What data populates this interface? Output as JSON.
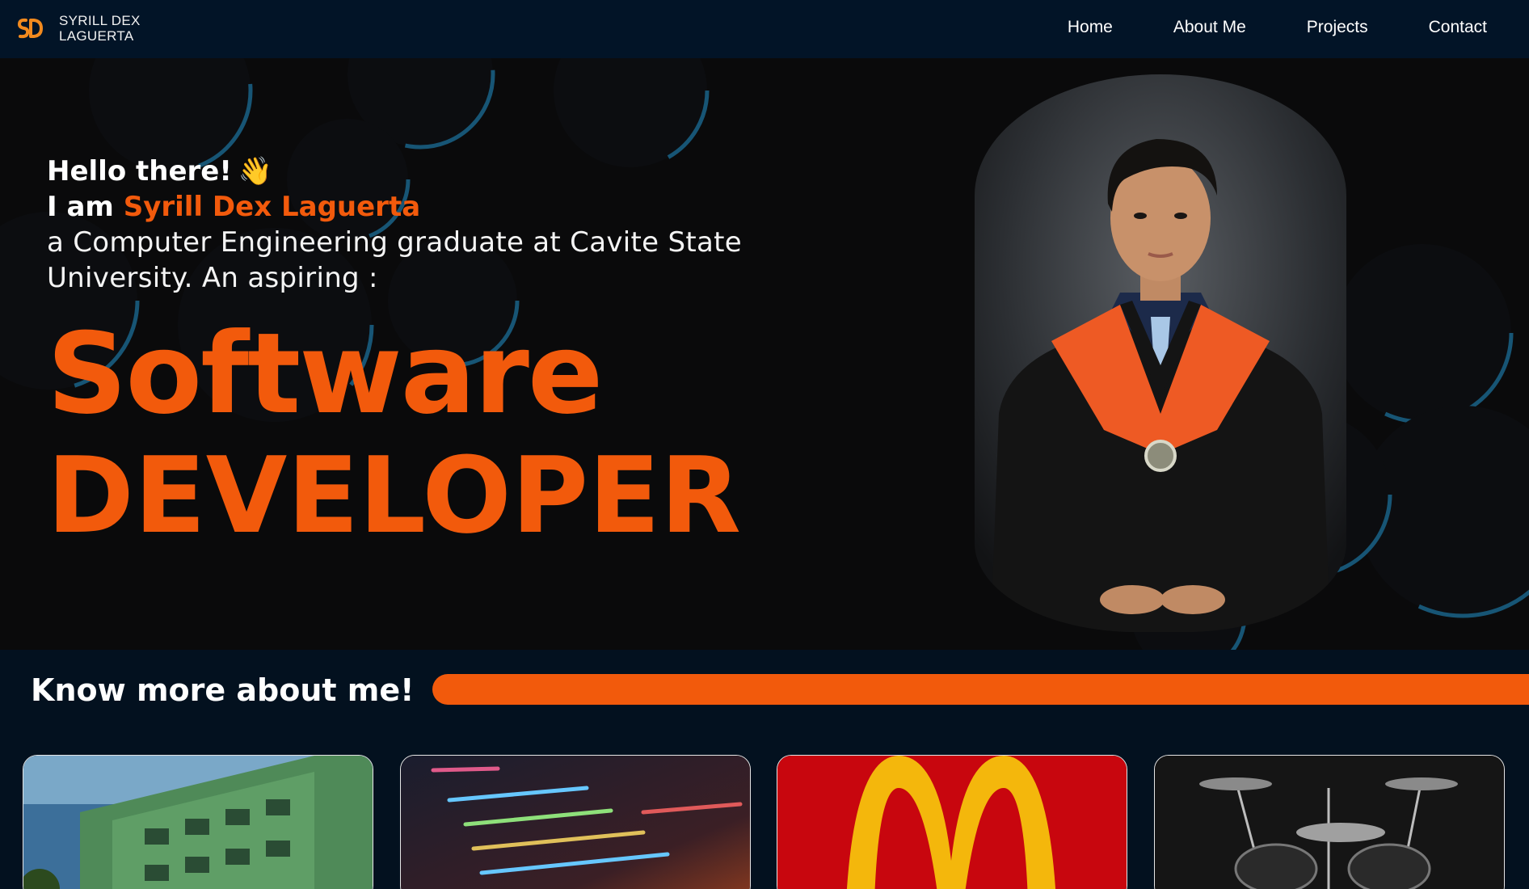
{
  "nav": {
    "logo_mark": "SD",
    "logo_line1": "SYRILL DEX",
    "logo_line2": "LAGUERTA",
    "links": [
      "Home",
      "About Me",
      "Projects",
      "Contact"
    ]
  },
  "hero": {
    "greeting": "Hello there!",
    "wave": "👋",
    "iam_prefix": "I am ",
    "name": "Syrill Dex Laguerta",
    "description": "a Computer Engineering graduate at Cavite State University. An aspiring :",
    "role_line1": "Software",
    "role_line2": "DEVELOPER"
  },
  "about": {
    "title": "Know more about me!",
    "cards": [
      {
        "name": "school-building-card"
      },
      {
        "name": "code-card"
      },
      {
        "name": "mcdonalds-card"
      },
      {
        "name": "drums-card"
      }
    ]
  },
  "colors": {
    "accent": "#f25a0c",
    "nav_bg": "#021427",
    "hero_bg": "#0a0a0b",
    "page_bg": "#03111f",
    "ring_blue": "#2aa6e0"
  },
  "icons": [
    "sd-logo-icon",
    "waving-hand-icon"
  ]
}
